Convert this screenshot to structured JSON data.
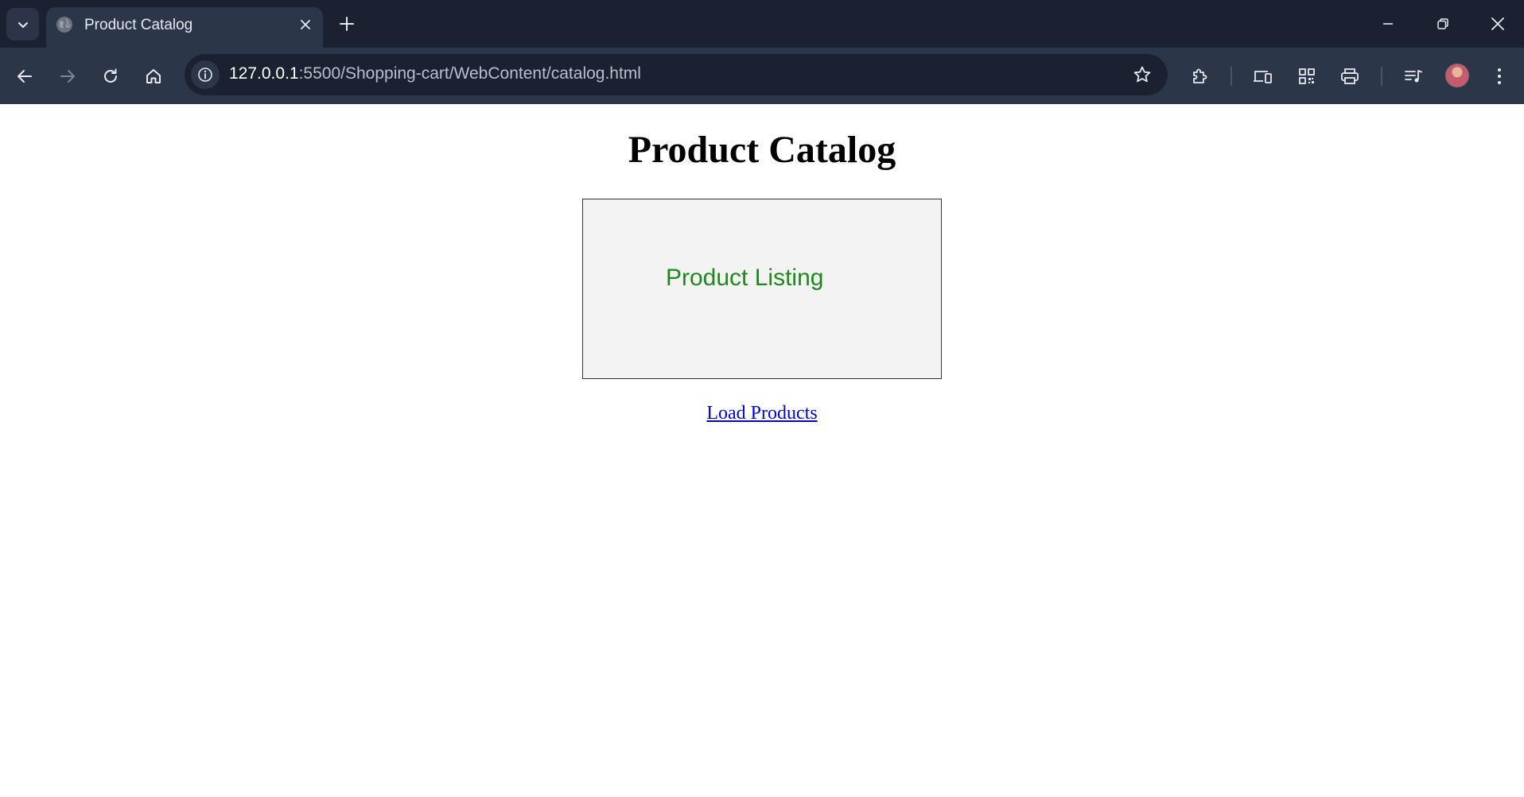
{
  "browser": {
    "tab": {
      "title": "Product Catalog"
    },
    "address_bar": {
      "url_host": "127.0.0.1",
      "url_path": ":5500/Shopping-cart/WebContent/catalog.html"
    },
    "icons": {
      "tab_search": "chevron-down-icon",
      "tab_favicon": "globe-icon",
      "tab_close": "close-icon",
      "new_tab": "plus-icon",
      "minimize": "minimize-icon",
      "restore": "restore-icon",
      "close_window": "close-icon",
      "back": "arrow-left-icon",
      "forward": "arrow-right-icon",
      "reload": "reload-icon",
      "home": "home-icon",
      "site_info": "info-icon",
      "bookmark": "star-icon",
      "extensions": "puzzle-icon",
      "devices": "devices-icon",
      "qr": "qr-code-icon",
      "print": "printer-icon",
      "media": "playlist-icon",
      "menu": "more-vertical-icon"
    },
    "colors": {
      "tabstrip_bg": "#1a2232",
      "toolbar_bg": "#2c3649"
    }
  },
  "page": {
    "title": "Product Catalog",
    "listing_label": "Product Listing",
    "load_link": "Load Products",
    "colors": {
      "listing_text": "#1e8a1e",
      "listing_bg": "#f3f3f3",
      "link": "#0000ee"
    }
  }
}
